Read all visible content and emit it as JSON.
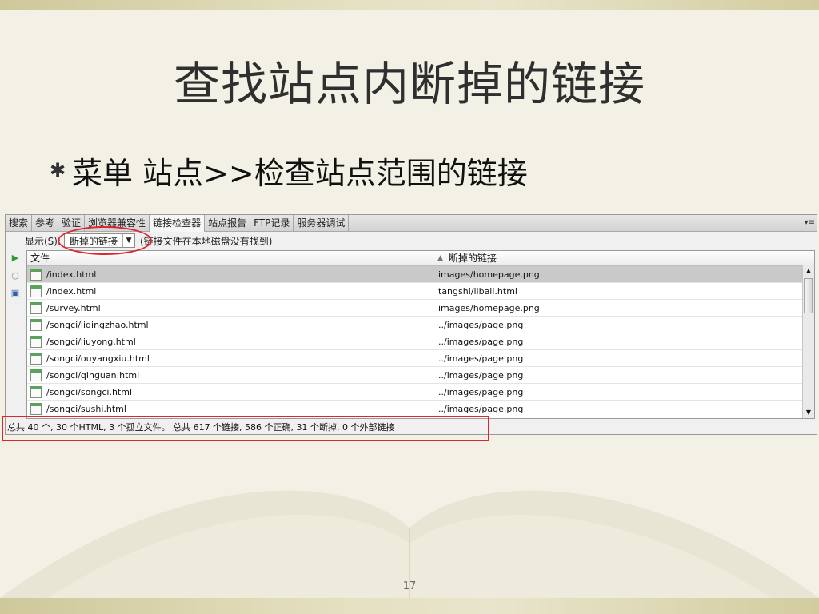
{
  "slide": {
    "title": "查找站点内断掉的链接",
    "bullet_symbol": "✱",
    "bullet": "菜单 站点>>检查站点范围的链接",
    "page_number": "17"
  },
  "panel": {
    "tabs": [
      {
        "label": "搜索",
        "active": false
      },
      {
        "label": "参考",
        "active": false
      },
      {
        "label": "验证",
        "active": false
      },
      {
        "label": "浏览器兼容性",
        "active": false
      },
      {
        "label": "链接检查器",
        "active": true
      },
      {
        "label": "站点报告",
        "active": false
      },
      {
        "label": "FTP记录",
        "active": false
      },
      {
        "label": "服务器调试",
        "active": false
      }
    ],
    "options_icon": "▾≡",
    "show_label": "显示(S):",
    "filter_value": "断掉的链接",
    "filter_arrow": "▼",
    "filter_note": "(链接文件在本地磁盘没有找到)",
    "tools": [
      {
        "name": "run-icon",
        "glyph": "▶",
        "color": "#2e9b2e"
      },
      {
        "name": "stop-icon",
        "glyph": "○",
        "color": "#888888"
      },
      {
        "name": "save-report-icon",
        "glyph": "▣",
        "color": "#2a5ea8"
      }
    ],
    "columns": {
      "file": "文件",
      "broken": "断掉的链接",
      "sort_arrow": "▲"
    },
    "rows": [
      {
        "file": "/index.html",
        "broken": "images/homepage.png",
        "selected": true
      },
      {
        "file": "/index.html",
        "broken": "tangshi/libaii.html",
        "selected": false
      },
      {
        "file": "/survey.html",
        "broken": "images/homepage.png",
        "selected": false
      },
      {
        "file": "/songci/liqingzhao.html",
        "broken": "../images/page.png",
        "selected": false
      },
      {
        "file": "/songci/liuyong.html",
        "broken": "../images/page.png",
        "selected": false
      },
      {
        "file": "/songci/ouyangxiu.html",
        "broken": "../images/page.png",
        "selected": false
      },
      {
        "file": "/songci/qinguan.html",
        "broken": "../images/page.png",
        "selected": false
      },
      {
        "file": "/songci/songci.html",
        "broken": "../images/page.png",
        "selected": false
      },
      {
        "file": "/songci/sushi.html",
        "broken": "../images/page.png",
        "selected": false
      }
    ],
    "scroll_up": "▲",
    "scroll_down": "▼",
    "status": "总共 40 个, 30 个HTML, 3 个孤立文件。 总共 617 个链接, 586 个正确, 31 个断掉, 0 个外部链接"
  },
  "colors": {
    "highlight": "#e0262c",
    "background": "#f3f1e6"
  }
}
